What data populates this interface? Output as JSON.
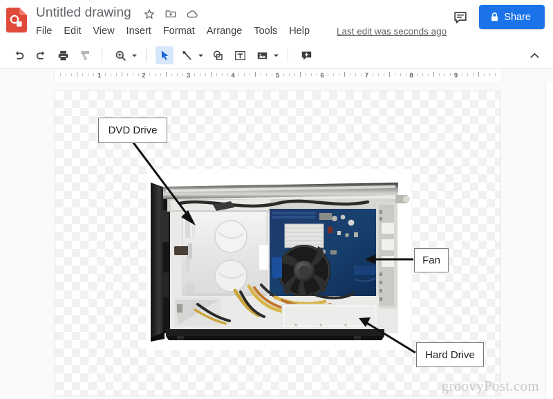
{
  "app": {
    "icon_name": "google-drawings-icon",
    "accent_color": "#1a73e8",
    "brand_color": "#db4437"
  },
  "header": {
    "doc_title": "Untitled drawing",
    "title_icons": [
      {
        "name": "star-icon",
        "label": "Star"
      },
      {
        "name": "move-to-folder-icon",
        "label": "Move to folder"
      },
      {
        "name": "cloud-status-icon",
        "label": "See document status"
      }
    ],
    "menus": [
      "File",
      "Edit",
      "View",
      "Insert",
      "Format",
      "Arrange",
      "Tools",
      "Help"
    ],
    "last_edit": "Last edit was seconds ago",
    "comment_icon": "comment-icon",
    "share_label": "Share",
    "share_lock_icon": "lock-icon"
  },
  "toolbar": {
    "items": [
      {
        "name": "undo-button",
        "label": "Undo",
        "state": "enabled"
      },
      {
        "name": "redo-button",
        "label": "Redo",
        "state": "enabled"
      },
      {
        "name": "print-button",
        "label": "Print",
        "state": "enabled"
      },
      {
        "name": "paint-format-button",
        "label": "Paint format",
        "state": "disabled"
      },
      {
        "name": "zoom-button",
        "label": "Zoom",
        "state": "enabled"
      },
      {
        "name": "select-tool-button",
        "label": "Select",
        "state": "active"
      },
      {
        "name": "line-tool-button",
        "label": "Line",
        "state": "enabled"
      },
      {
        "name": "shape-tool-button",
        "label": "Shape",
        "state": "enabled"
      },
      {
        "name": "textbox-tool-button",
        "label": "Text box",
        "state": "enabled"
      },
      {
        "name": "image-tool-button",
        "label": "Image",
        "state": "enabled"
      },
      {
        "name": "comment-tool-button",
        "label": "Add comment",
        "state": "enabled"
      }
    ],
    "collapse_icon": "chevron-up-icon"
  },
  "ruler": {
    "unit": "inches",
    "numbers": [
      1,
      2,
      3,
      4,
      5,
      6,
      7,
      8,
      9
    ],
    "min": 0,
    "max": 10
  },
  "canvas": {
    "background": "transparent-checkerboard",
    "labels": [
      {
        "name": "label-dvd-drive",
        "text": "DVD Drive"
      },
      {
        "name": "label-fan",
        "text": "Fan"
      },
      {
        "name": "label-hard-drive",
        "text": "Hard Drive"
      }
    ],
    "image_alt": "Open desktop computer case interior showing DVD drive bay, motherboard with CPU fan and hard drive",
    "watermark": "groovyPost.com"
  }
}
